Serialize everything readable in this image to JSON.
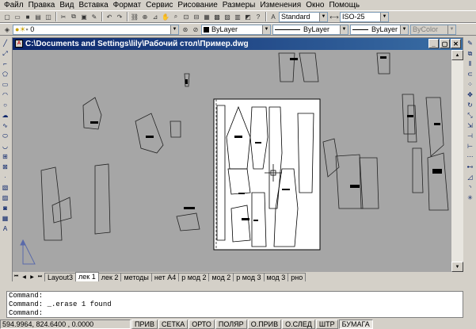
{
  "menu": [
    "Файл",
    "Правка",
    "Вид",
    "Вставка",
    "Формат",
    "Сервис",
    "Рисование",
    "Размеры",
    "Изменения",
    "Окно",
    "Помощь"
  ],
  "toolbar": {
    "text_style": "Standard",
    "dim_style": "ISO-25",
    "layer": "0",
    "color": "ByLayer",
    "linetype": "ByLayer",
    "lineweight": "ByLayer",
    "plotstyle": "ByColor"
  },
  "window": {
    "title": "C:\\Documents and Settings\\lily\\Рабочий стол\\Пример.dwg"
  },
  "tabs": [
    "Layout3",
    "лек 1",
    "лек 2",
    "методы",
    "нет А4",
    "р мод 2",
    "мод 2",
    "р мод 3",
    "мод 3",
    "рно"
  ],
  "active_tab": "лек 1",
  "command_lines": [
    "Command:",
    "Command: _.erase 1 found",
    "Command:"
  ],
  "status": {
    "coords": "594.9964, 824.6400 , 0.0000",
    "toggles": [
      "ПРИВ",
      "СЕТКА",
      "ОРТО",
      "ПОЛЯР",
      "О.ПРИВ",
      "О.СЛЕД",
      "ШТР",
      "БУМАГА"
    ],
    "active_toggle": "БУМАГА"
  },
  "icons": [
    "new-icon",
    "open-icon",
    "save-icon",
    "print-icon",
    "cut-icon",
    "copy-icon",
    "paste-icon",
    "undo-icon",
    "redo-icon",
    "pan-icon",
    "zoom-icon",
    "help-icon",
    "layer-icon"
  ]
}
